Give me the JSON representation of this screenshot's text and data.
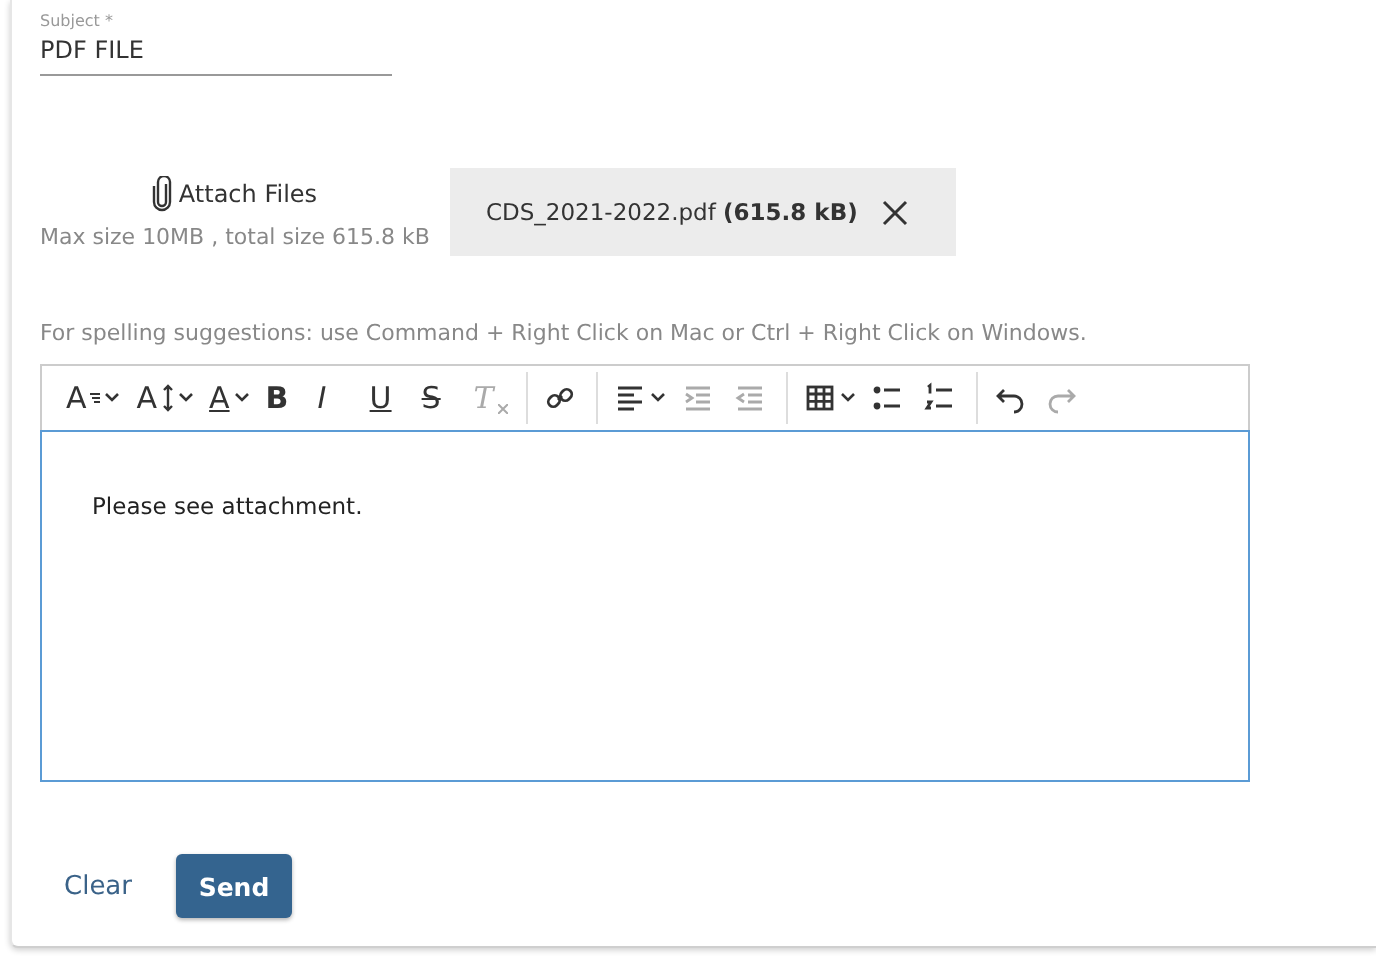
{
  "subject": {
    "label": "Subject *",
    "value": "PDF FILE"
  },
  "attach": {
    "label": "Attach Files",
    "limits": "Max size 10MB , total size 615.8 kB"
  },
  "attachments": [
    {
      "name": "CDS_2021-2022.pdf",
      "size": "(615.8 kB)"
    }
  ],
  "hint": "For spelling suggestions: use Command + Right Click on Mac or Ctrl + Right Click on Windows.",
  "toolbar": [
    [
      {
        "kind": "font-family",
        "glyph": "A",
        "dropdown": true,
        "disabled": false
      },
      {
        "kind": "font-size",
        "glyph": "A",
        "dropdown": true,
        "disabled": false
      },
      {
        "kind": "text-color",
        "glyph": "A",
        "dropdown": true,
        "disabled": false
      },
      {
        "kind": "bold",
        "glyph": "B",
        "dropdown": false,
        "disabled": false
      },
      {
        "kind": "italic",
        "glyph": "I",
        "dropdown": false,
        "disabled": false
      },
      {
        "kind": "underline",
        "glyph": "U",
        "dropdown": false,
        "disabled": false
      },
      {
        "kind": "strike",
        "glyph": "S",
        "dropdown": false,
        "disabled": false
      },
      {
        "kind": "clear-format",
        "glyph": "T",
        "dropdown": false,
        "disabled": true
      }
    ],
    [
      {
        "kind": "link",
        "dropdown": false,
        "disabled": false
      }
    ],
    [
      {
        "kind": "align",
        "dropdown": true,
        "disabled": false
      },
      {
        "kind": "indent",
        "dropdown": false,
        "disabled": true
      },
      {
        "kind": "outdent",
        "dropdown": false,
        "disabled": true
      }
    ],
    [
      {
        "kind": "table",
        "dropdown": true,
        "disabled": false
      },
      {
        "kind": "bullets",
        "dropdown": false,
        "disabled": false
      },
      {
        "kind": "numbers",
        "dropdown": false,
        "disabled": false
      }
    ],
    [
      {
        "kind": "undo",
        "dropdown": false,
        "disabled": false
      },
      {
        "kind": "redo",
        "dropdown": false,
        "disabled": true
      }
    ]
  ],
  "body": "Please see attachment.",
  "buttons": {
    "clear": "Clear",
    "send": "Send"
  }
}
